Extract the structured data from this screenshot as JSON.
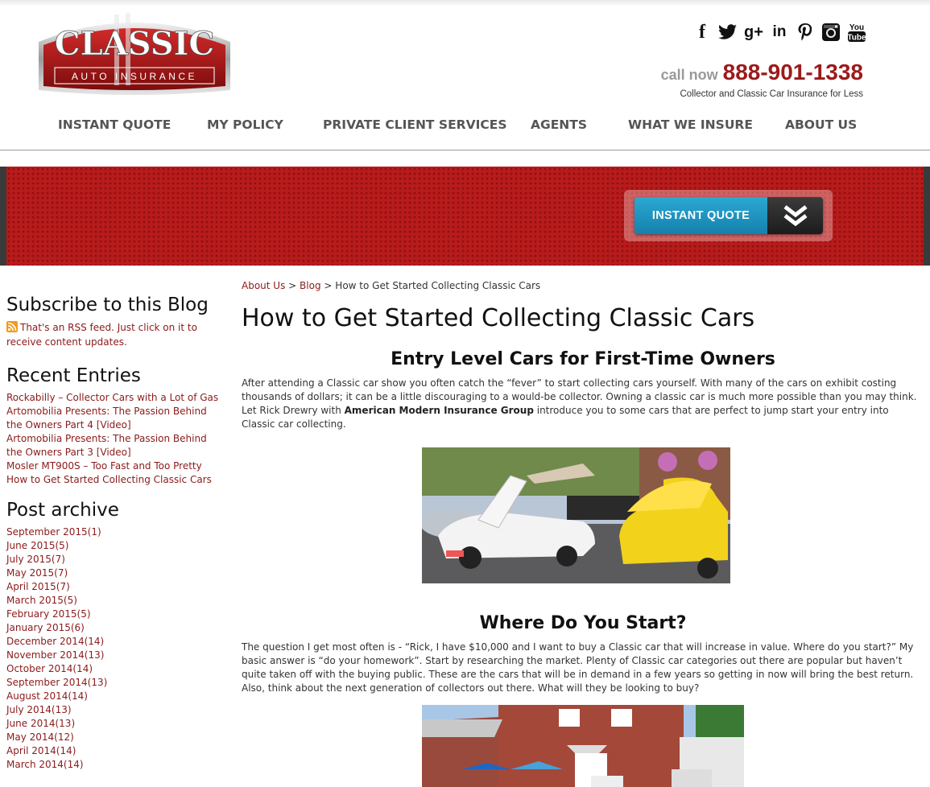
{
  "header": {
    "logo_main": "CLASSIC",
    "logo_sub": "AUTO INSURANCE",
    "social_icons": [
      "facebook-icon",
      "twitter-icon",
      "google-plus-icon",
      "linkedin-icon",
      "pinterest-icon",
      "instagram-icon",
      "youtube-icon"
    ],
    "call_label": "call now",
    "phone": "888-901-1338",
    "tagline": "Collector and Classic Car Insurance for Less"
  },
  "nav": {
    "items": [
      "INSTANT QUOTE",
      "MY POLICY",
      "PRIVATE CLIENT SERVICES",
      "AGENTS",
      "WHAT WE INSURE",
      "ABOUT US"
    ]
  },
  "banner": {
    "button_label": "INSTANT QUOTE"
  },
  "sidebar": {
    "subscribe_title": "Subscribe to this Blog",
    "rss_text": "That's an RSS feed. Just click on it to receive content updates.",
    "recent_title": "Recent Entries",
    "recent_entries": [
      "Rockabilly – Collector Cars with a Lot of Gas",
      "Artomobilia Presents: The Passion Behind the Owners Part 4 [Video]",
      "Artomobilia Presents: The Passion Behind the Owners Part 3 [Video]",
      "Mosler MT900S – Too Fast and Too Pretty",
      "How to Get Started Collecting Classic Cars"
    ],
    "archive_title": "Post archive",
    "archive": [
      "September 2015(1)",
      "June 2015(5)",
      "July 2015(7)",
      "May 2015(7)",
      "April 2015(7)",
      "March 2015(5)",
      "February 2015(5)",
      "January 2015(6)",
      "December 2014(14)",
      "November 2014(13)",
      "October 2014(14)",
      "September 2014(13)",
      "August 2014(14)",
      "July 2014(13)",
      "June 2014(13)",
      "May 2014(12)",
      "April 2014(14)",
      "March 2014(14)"
    ]
  },
  "main": {
    "breadcrumb": [
      "About Us",
      "Blog",
      "How to Get Started Collecting Classic Cars"
    ],
    "breadcrumb_sep": ">",
    "title": "How to Get Started Collecting Classic Cars",
    "section1_heading": "Entry Level Cars for First-Time Owners",
    "section1_text_a": "After attending a Classic car show you often catch the “fever” to start collecting cars yourself. With many of the cars on exhibit costing thousands of dollars; it can be a little discouraging to a would-be collector. Owning a classic car is much more possible than you may think. Let Rick Drewry with ",
    "section1_bold": "American Modern Insurance Group",
    "section1_text_b": " introduce you to some cars that are perfect to jump start your entry into Classic car collecting.",
    "section2_heading": "Where Do You Start?",
    "section2_text": "The question I get most often is - “Rick, I have $10,000 and I want to buy a Classic car that will increase in value. Where do you start?” My basic answer is “do your homework”. Start by researching the market. Plenty of Classic car categories out there are popular but haven’t quite taken off with the buying public. These are the cars that will be in demand in a few years so getting in now will bring the best return. Also, think about the next generation of collectors out there. What will they be looking to buy?"
  },
  "colors": {
    "brand_red": "#9c1a1a",
    "link_red": "#8b1a1a",
    "banner_red": "#b81b1b",
    "button_blue": "#1f95c2"
  }
}
